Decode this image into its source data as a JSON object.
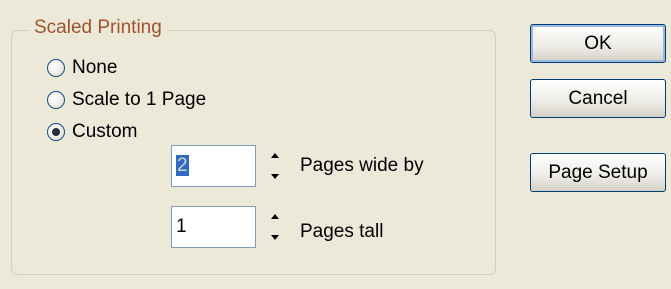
{
  "group": {
    "title": "Scaled Printing"
  },
  "radios": [
    {
      "label": "None",
      "checked": false
    },
    {
      "label": "Scale to 1 Page",
      "checked": false
    },
    {
      "label": "Custom",
      "checked": true
    }
  ],
  "pages_wide": {
    "value": "2",
    "label": "Pages wide by"
  },
  "pages_tall": {
    "value": "1",
    "label": "Pages tall"
  },
  "buttons": {
    "ok": "OK",
    "cancel": "Cancel",
    "page_setup": "Page Setup"
  }
}
